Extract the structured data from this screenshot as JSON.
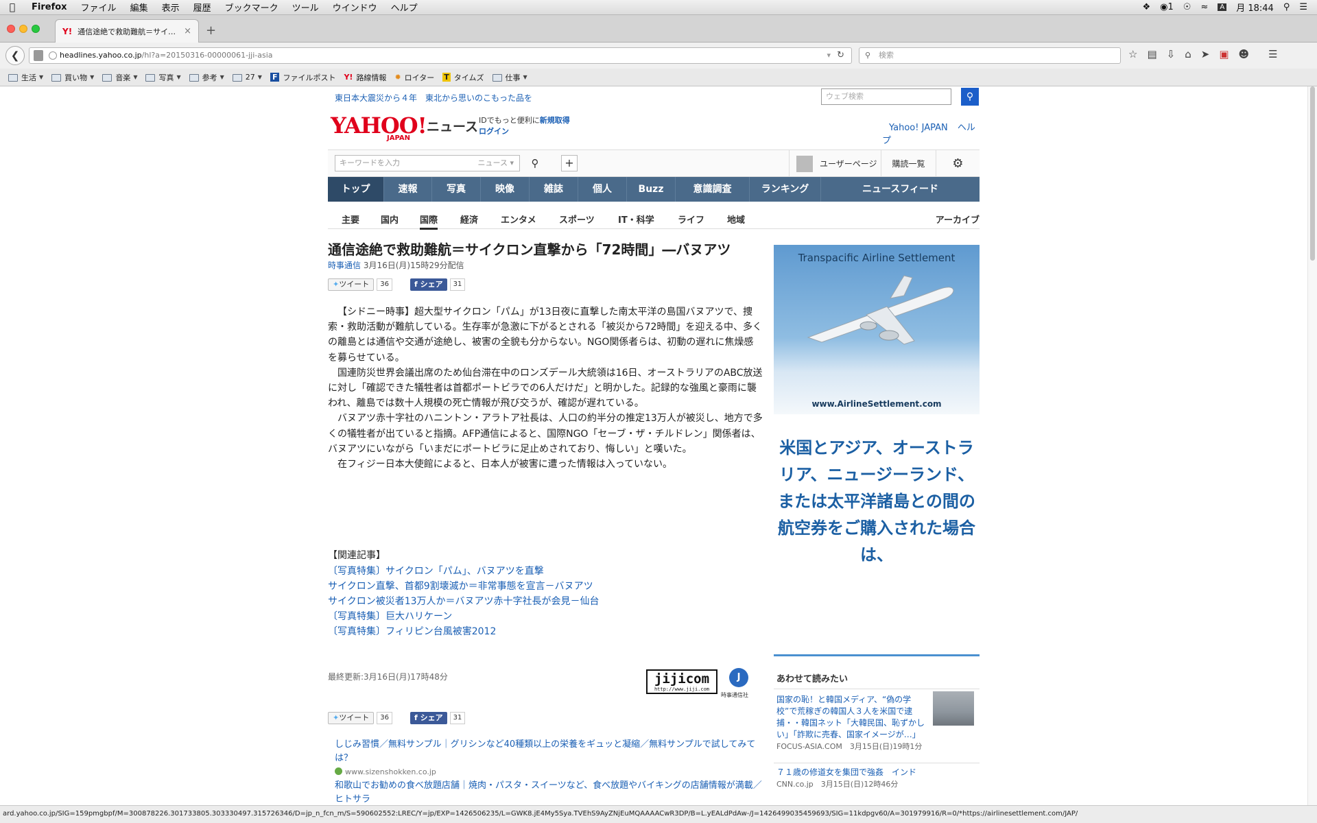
{
  "menubar": {
    "app": "Firefox",
    "items": [
      "ファイル",
      "編集",
      "表示",
      "履歴",
      "ブックマーク",
      "ツール",
      "ウインドウ",
      "ヘルプ"
    ],
    "badge": "1",
    "input_indicator": "A",
    "clock": "月 18:44"
  },
  "tab": {
    "title": "通信途絶で救助難航＝サイ…",
    "favicon": "Y!"
  },
  "urlbar": {
    "host": "headlines.yahoo.co.jp",
    "path": "/hl?a=20150316-00000061-jji-asia"
  },
  "searchbar": {
    "placeholder": "検索"
  },
  "bookmarks": [
    "生活",
    "買い物",
    "音楽",
    "写真",
    "参考",
    "27",
    "ファイルポスト",
    "路線情報",
    "ロイター",
    "タイムズ",
    "仕事"
  ],
  "site": {
    "promo": "東日本大震災から４年　東北から思いのこもった品を",
    "web_search_placeholder": "ウェブ検索",
    "logo": "YAHOO!",
    "logo_sub": "JAPAN",
    "section": "ニュース",
    "login_text": "IDでもっと便利に",
    "signup": "新規取得",
    "login": "ログイン",
    "header_links": [
      "Yahoo! JAPAN",
      "ヘルプ"
    ],
    "keyword_placeholder": "キーワードを入力",
    "keyword_scope": "ニュース",
    "user_page": "ユーザーページ",
    "subscriptions": "購読一覧",
    "global_nav": [
      "トップ",
      "速報",
      "写真",
      "映像",
      "雑誌",
      "個人",
      "Buzz",
      "意識調査",
      "ランキング",
      "ニュースフィード"
    ],
    "sub_nav": [
      "主要",
      "国内",
      "国際",
      "経済",
      "エンタメ",
      "スポーツ",
      "IT・科学",
      "ライフ",
      "地域"
    ],
    "archive": "アーカイブ"
  },
  "article": {
    "title": "通信途絶で救助難航＝サイクロン直撃から「72時間」―バヌアツ",
    "source": "時事通信",
    "date": "3月16日(月)15時29分配信",
    "tweet": "ツイート",
    "tweet_count": "36",
    "share": "シェア",
    "share_count": "31",
    "paragraphs": [
      "【シドニー時事】超大型サイクロン「パム」が13日夜に直撃した南太平洋の島国バヌアツで、捜索・救助活動が難航している。生存率が急激に下がるとされる「被災から72時間」を迎える中、多くの離島とは通信や交通が途絶し、被害の全貌も分からない。NGO関係者らは、初動の遅れに焦燥感を募らせている。",
      "国連防災世界会議出席のため仙台滞在中のロンズデール大統領は16日、オーストラリアのABC放送に対し「確認できた犠牲者は首都ポートビラでの6人だけだ」と明かした。記録的な強風と豪雨に襲われ、離島では数十人規模の死亡情報が飛び交うが、確認が遅れている。",
      "バヌアツ赤十字社のハニントン・アラトア社長は、人口の約半分の推定13万人が被災し、地方で多くの犠牲者が出ていると指摘。AFP通信によると、国際NGO「セーブ・ザ・チルドレン」関係者は、バヌアツにいながら「いまだにポートビラに足止めされており、悔しい」と嘆いた。",
      "在フィジー日本大使館によると、日本人が被害に遭った情報は入っていない。"
    ],
    "related_heading": "【関連記事】",
    "related": [
      "〔写真特集〕サイクロン「パム」、バヌアツを直撃",
      "サイクロン直撃、首都9割壊滅か＝非常事態を宣言－バヌアツ",
      "サイクロン被災者13万人か＝バヌアツ赤十字社長が会見－仙台",
      "〔写真特集〕巨大ハリケーン",
      "〔写真特集〕フィリピン台風被害2012"
    ],
    "updated": "最終更新:3月16日(月)17時48分",
    "jiji_logo": "jijicom",
    "jiji_url": "http://www.jiji.com",
    "jiji_label": "時事通信社"
  },
  "ads": [
    {
      "title": "しじみ習慣／無料サンプル｜グリシンなど40種類以上の栄養をギュッと凝縮／無料サンプルで試してみては？",
      "domain": "www.sizenshokken.co.jp"
    },
    {
      "title": "和歌山でお勧めの食べ放題店舗｜焼肉・パスタ・スイーツなど、食べ放題やバイキングの店舗情報が満載／ヒトサラ"
    }
  ],
  "sidebar": {
    "ad_caption": "Transpacific Airline Settlement",
    "ad_url": "www.AirlineSettlement.com",
    "ad_text": "米国とアジア、オーストラリア、ニュージーランド、または太平洋諸島との間の航空券をご購入された場合は、",
    "related_heading": "あわせて読みたい",
    "items": [
      {
        "title": "国家の恥！と韓国メディア、“偽の学校”で荒稼ぎの韓国人３人を米国で逮捕・・韓国ネット「大韓民国、恥ずかしい」「詐欺に売春、国家イメージが…」",
        "meta": "FOCUS-ASIA.COM　3月15日(日)19時1分"
      },
      {
        "title": "７１歳の修道女を集団で強姦　インド",
        "meta": "CNN.co.jp　3月15日(日)12時46分"
      }
    ]
  },
  "status_url": "ard.yahoo.co.jp/SIG=159pmgbpf/M=300878226.301733805.303330497.315726346/D=jp_n_fcn_m/S=590602552:LREC/Y=jp/EXP=1426506235/L=GWK8.jE4My5Sya.TVEhS9AyZNjEuMQAAAACwR3DP/B=L.yEALdPdAw-/J=1426499035459693/SIG=11kdpgv60/A=301979916/R=0/*https://airlinesettlement.com/JAP/"
}
